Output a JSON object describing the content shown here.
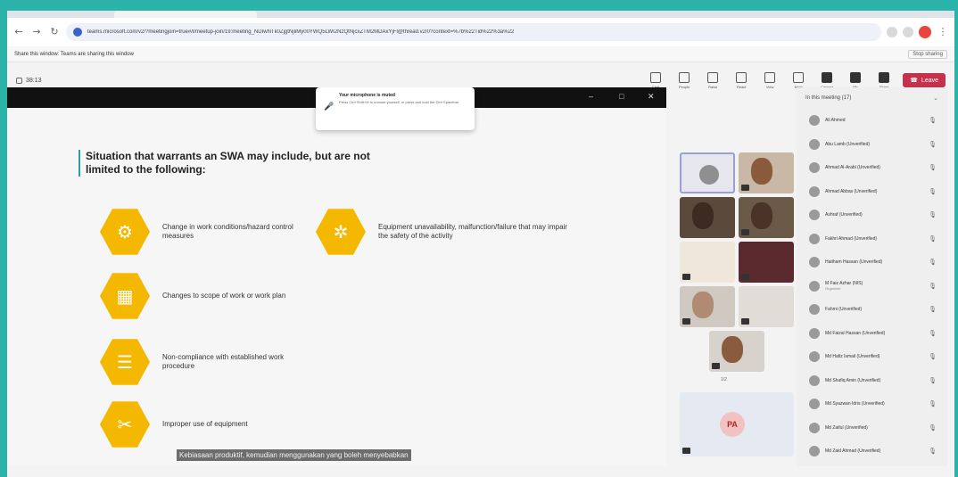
{
  "browser": {
    "url": "teams.microsoft.com/v2/?meetingjoin=true#/l/meetup-join/19:meeting_NDIwNTk0ZjgtNjliMy00YWQ5LWI2NzQtNjcxZTM2MDAxYjFl@thread.v2/0?context=%7b%22Tid%22%3a%22"
  },
  "share_banner": {
    "text": "Share this window: Teams are sharing this window",
    "stop": "Stop sharing"
  },
  "meeting": {
    "timer": "38:13",
    "tools": [
      {
        "label": "Chat",
        "icon": "chat-icon"
      },
      {
        "label": "People",
        "icon": "people-icon"
      },
      {
        "label": "Raise",
        "icon": "raise-hand-icon"
      },
      {
        "label": "React",
        "icon": "react-icon"
      },
      {
        "label": "View",
        "icon": "view-icon"
      },
      {
        "label": "More",
        "icon": "more-icon"
      },
      {
        "label": "Camera",
        "icon": "camera-icon"
      },
      {
        "label": "Mic",
        "icon": "mic-icon"
      },
      {
        "label": "Share",
        "icon": "share-icon"
      }
    ],
    "leave": "Leave"
  },
  "toast": {
    "title": "Your microphone is muted",
    "body": "Press Ctrl+Shift+M to unmute yourself, or press and hold the Ctrl+Spacebar"
  },
  "slide": {
    "heading": "Situation that warrants an SWA may include, but are not limited to the following:",
    "items": [
      {
        "text": "Change in work conditions/hazard control measures",
        "icon": "gears-icon",
        "glyph": "⚙"
      },
      {
        "text": "Equipment unavailability, malfunction/failure that may impair the safety of the activity",
        "icon": "cog-icon",
        "glyph": "✲"
      },
      {
        "text": "Changes to scope of work or work plan",
        "icon": "calendar-icon",
        "glyph": "▦"
      },
      {
        "text": "Non-compliance with established work procedure",
        "icon": "clipboard-icon",
        "glyph": "☰"
      },
      {
        "text": "Improper use of equipment",
        "icon": "tools-icon",
        "glyph": "✂"
      }
    ],
    "caption": "Kebiasaan produktif, kemudian menggunakan yang boleh menyebabkan"
  },
  "video_grid": {
    "pager": "1/2",
    "initials_tile": "PA"
  },
  "roster": {
    "title": "In this meeting (17)",
    "people": [
      {
        "name": "Ali Ahmed"
      },
      {
        "name": "Abu Lamb (Unverified)"
      },
      {
        "name": "Ahmad Al-Arabi (Unverified)"
      },
      {
        "name": "Ahmad Abbas (Unverified)"
      },
      {
        "name": "Ashraf (Unverified)"
      },
      {
        "name": "Fakhri Ahmad (Unverified)"
      },
      {
        "name": "Haitham Hassan (Unverified)"
      },
      {
        "name": "M Faiz Azhar (NIS)",
        "sub": "Organizer"
      },
      {
        "name": "Fahmi (Unverified)"
      },
      {
        "name": "Md Faizal Hassan (Unverified)"
      },
      {
        "name": "Md Hafiz Ismail (Unverified)"
      },
      {
        "name": "Md Shafiq Amin (Unverified)"
      },
      {
        "name": "Md Syazwan Idris (Unverified)"
      },
      {
        "name": "Md Zaiful (Unverified)"
      },
      {
        "name": "Md Zaid Ahmad (Unverified)"
      }
    ]
  }
}
